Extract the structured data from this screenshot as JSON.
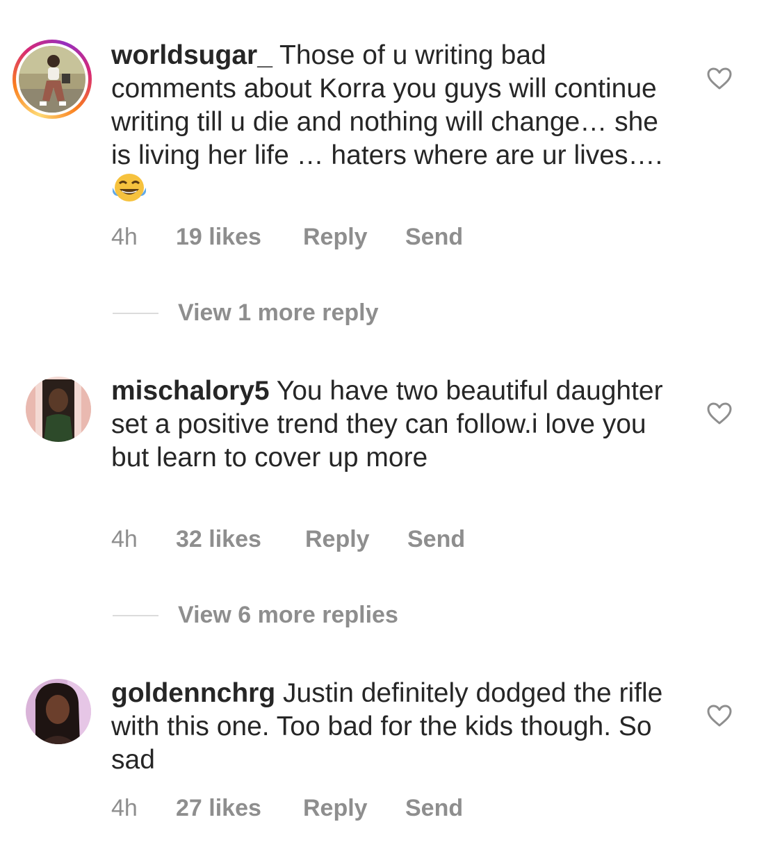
{
  "comments": [
    {
      "username": "worldsugar_",
      "text": "Those of u writing bad comments about Korra you guys will continue writing till u die and nothing will change… she is living her life … haters where are ur lives…. ",
      "emoji": "face-with-tears-of-joy",
      "time": "4h",
      "likes": "19 likes",
      "reply": "Reply",
      "send": "Send",
      "view_replies": "View 1 more reply",
      "has_story_ring": true
    },
    {
      "username": "mischalory5",
      "text": "You have two beautiful daughter set a positive trend they can follow.i love you but learn to cover up more",
      "time": "4h",
      "likes": "32 likes",
      "reply": "Reply",
      "send": "Send",
      "view_replies": "View 6 more replies",
      "has_story_ring": false
    },
    {
      "username": "goldennchrg",
      "text": "Justin definitely dodged the rifle with this one. Too bad for the kids though. So sad",
      "time": "4h",
      "likes": "27 likes",
      "reply": "Reply",
      "send": "Send",
      "has_story_ring": false
    }
  ],
  "icons": {
    "like": "heart-outline-icon"
  },
  "colors": {
    "text_primary": "#262626",
    "text_secondary": "#8e8e8e",
    "divider": "#dbdbdb",
    "story_ring": [
      "#feda75",
      "#fa7e1e",
      "#d62976",
      "#962fbf"
    ]
  }
}
